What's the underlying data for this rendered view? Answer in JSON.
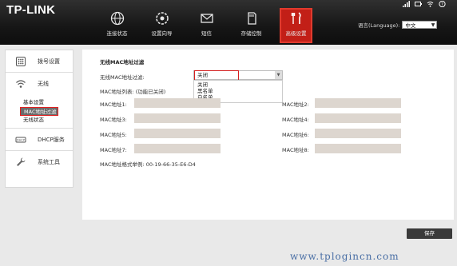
{
  "brand": "TP-LINK",
  "nav": [
    {
      "label": "连接状态",
      "icon": "globe-icon"
    },
    {
      "label": "设置向导",
      "icon": "wizard-icon"
    },
    {
      "label": "短信",
      "icon": "mail-icon"
    },
    {
      "label": "存储控制",
      "icon": "sd-card-icon"
    },
    {
      "label": "高级设置",
      "icon": "tools-icon",
      "active": true
    }
  ],
  "language": {
    "label": "语言(Language):",
    "value": "中文"
  },
  "sidebar": {
    "items": [
      {
        "label": "拨号设置",
        "icon": "dial-icon"
      },
      {
        "label": "无线",
        "icon": "wifi-icon"
      },
      {
        "label": "DHCP服务",
        "icon": "dhcp-icon"
      },
      {
        "label": "系统工具",
        "icon": "wrench-icon"
      }
    ],
    "sub_items": [
      {
        "label": "基本设置"
      },
      {
        "label": "MAC地址过滤",
        "selected": true
      },
      {
        "label": "无线状态"
      }
    ]
  },
  "main": {
    "title": "无线MAC地址过滤",
    "filter_label": "无线MAC地址过滤:",
    "filter_value": "关闭",
    "options": [
      "关闭",
      "黑名单",
      "白名单"
    ],
    "list_label": "MAC地址列表: (功能已关闭)",
    "mac_labels": [
      "MAC地址1:",
      "MAC地址2:",
      "MAC地址3:",
      "MAC地址4:",
      "MAC地址5:",
      "MAC地址6:",
      "MAC地址7:",
      "MAC地址8:"
    ],
    "format_example": "MAC地址格式举例: 00-19-66-35-E6-D4"
  },
  "save_label": "保存",
  "watermark": "www.tplogincn.com",
  "colors": {
    "accent": "#c21f17",
    "highlight_border": "#e02020",
    "topbar": "#1a1a1a",
    "input_fill": "#ddd6cf"
  }
}
